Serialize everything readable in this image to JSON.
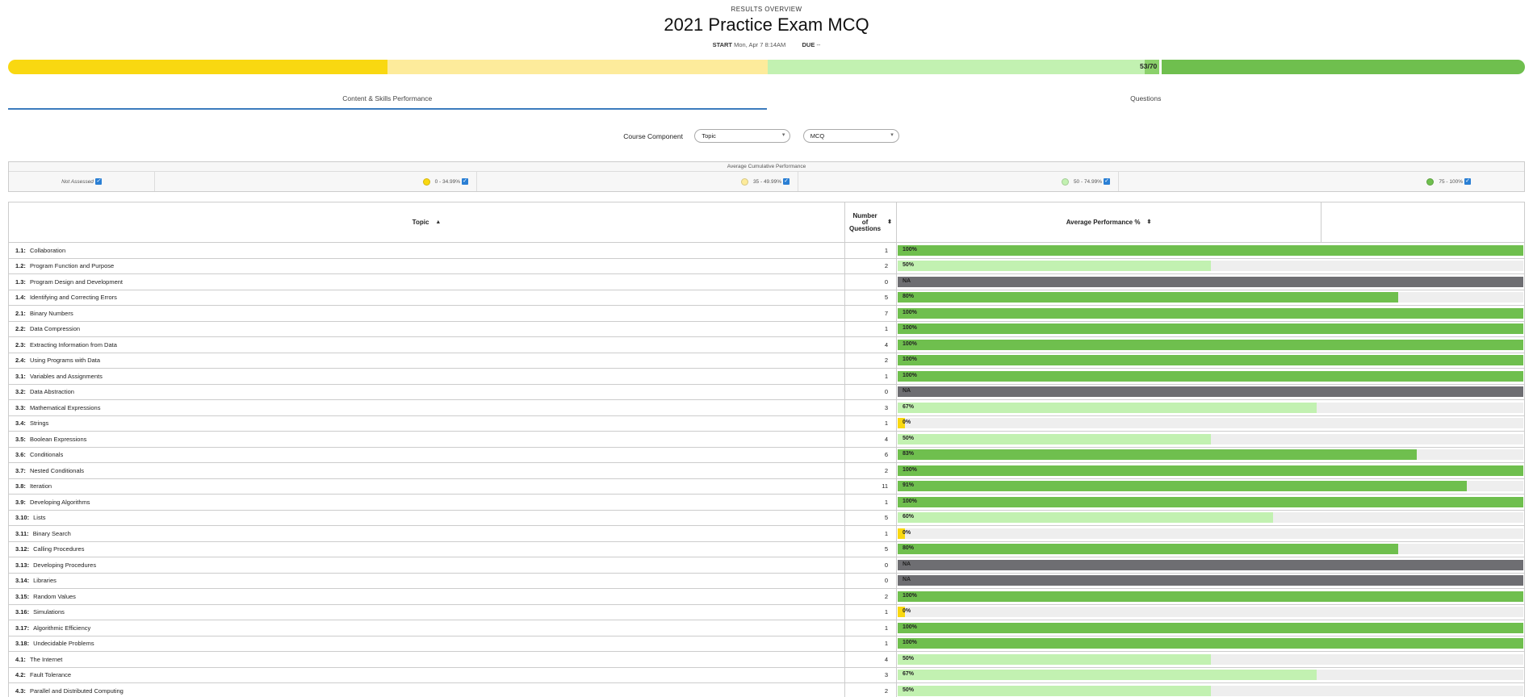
{
  "header": {
    "eyebrow": "RESULTS OVERVIEW",
    "title": "2021 Practice Exam MCQ",
    "start_label": "START",
    "start_value": "Mon, Apr 7 8:14AM",
    "due_label": "DUE",
    "due_value": "--"
  },
  "score": {
    "label": "53/70",
    "fraction": 0.757
  },
  "tabs": [
    {
      "label": "Content & Skills Performance",
      "active": true
    },
    {
      "label": "Questions",
      "active": false
    }
  ],
  "filters": {
    "label": "Course Component",
    "select1": "Topic",
    "select2": "MCQ"
  },
  "legend": {
    "title": "Average Cumulative Performance",
    "items": [
      {
        "label": "Not Assessed",
        "color": null
      },
      {
        "label": "0 - 34.99%",
        "color": "#f9d811"
      },
      {
        "label": "35 - 49.99%",
        "color": "#fdeb9b"
      },
      {
        "label": "50 - 74.99%",
        "color": "#c2f1b1"
      },
      {
        "label": "75 - 100%",
        "color": "#6fbf4e"
      }
    ]
  },
  "table": {
    "headers": {
      "topic": "Topic",
      "num_line1": "Number",
      "num_line2": "of",
      "num_line3": "Questions",
      "perf": "Average Performance %"
    },
    "rows": [
      {
        "code": "1.1:",
        "name": "Collaboration",
        "count": "1",
        "pct": 100,
        "label": "100%"
      },
      {
        "code": "1.2:",
        "name": "Program Function and Purpose",
        "count": "2",
        "pct": 50,
        "label": "50%"
      },
      {
        "code": "1.3:",
        "name": "Program Design and Development",
        "count": "0",
        "pct": null,
        "label": "NA"
      },
      {
        "code": "1.4:",
        "name": "Identifying and Correcting Errors",
        "count": "5",
        "pct": 80,
        "label": "80%"
      },
      {
        "code": "2.1:",
        "name": "Binary Numbers",
        "count": "7",
        "pct": 100,
        "label": "100%"
      },
      {
        "code": "2.2:",
        "name": "Data Compression",
        "count": "1",
        "pct": 100,
        "label": "100%"
      },
      {
        "code": "2.3:",
        "name": "Extracting Information from Data",
        "count": "4",
        "pct": 100,
        "label": "100%"
      },
      {
        "code": "2.4:",
        "name": "Using Programs with Data",
        "count": "2",
        "pct": 100,
        "label": "100%"
      },
      {
        "code": "3.1:",
        "name": "Variables and Assignments",
        "count": "1",
        "pct": 100,
        "label": "100%"
      },
      {
        "code": "3.2:",
        "name": "Data Abstraction",
        "count": "0",
        "pct": null,
        "label": "NA"
      },
      {
        "code": "3.3:",
        "name": "Mathematical Expressions",
        "count": "3",
        "pct": 67,
        "label": "67%"
      },
      {
        "code": "3.4:",
        "name": "Strings",
        "count": "1",
        "pct": 0,
        "label": "0%"
      },
      {
        "code": "3.5:",
        "name": "Boolean Expressions",
        "count": "4",
        "pct": 50,
        "label": "50%"
      },
      {
        "code": "3.6:",
        "name": "Conditionals",
        "count": "6",
        "pct": 83,
        "label": "83%"
      },
      {
        "code": "3.7:",
        "name": "Nested Conditionals",
        "count": "2",
        "pct": 100,
        "label": "100%"
      },
      {
        "code": "3.8:",
        "name": "Iteration",
        "count": "11",
        "pct": 91,
        "label": "91%"
      },
      {
        "code": "3.9:",
        "name": "Developing Algorithms",
        "count": "1",
        "pct": 100,
        "label": "100%"
      },
      {
        "code": "3.10:",
        "name": "Lists",
        "count": "5",
        "pct": 60,
        "label": "60%"
      },
      {
        "code": "3.11:",
        "name": "Binary Search",
        "count": "1",
        "pct": 0,
        "label": "0%"
      },
      {
        "code": "3.12:",
        "name": "Calling Procedures",
        "count": "5",
        "pct": 80,
        "label": "80%"
      },
      {
        "code": "3.13:",
        "name": "Developing Procedures",
        "count": "0",
        "pct": null,
        "label": "NA"
      },
      {
        "code": "3.14:",
        "name": "Libraries",
        "count": "0",
        "pct": null,
        "label": "NA"
      },
      {
        "code": "3.15:",
        "name": "Random Values",
        "count": "2",
        "pct": 100,
        "label": "100%"
      },
      {
        "code": "3.16:",
        "name": "Simulations",
        "count": "1",
        "pct": 0,
        "label": "0%"
      },
      {
        "code": "3.17:",
        "name": "Algorithmic Efficiency",
        "count": "1",
        "pct": 100,
        "label": "100%"
      },
      {
        "code": "3.18:",
        "name": "Undecidable Problems",
        "count": "1",
        "pct": 100,
        "label": "100%"
      },
      {
        "code": "4.1:",
        "name": "The Internet",
        "count": "4",
        "pct": 50,
        "label": "50%"
      },
      {
        "code": "4.2:",
        "name": "Fault Tolerance",
        "count": "3",
        "pct": 67,
        "label": "67%"
      },
      {
        "code": "4.3:",
        "name": "Parallel and Distributed Computing",
        "count": "2",
        "pct": 50,
        "label": "50%"
      }
    ]
  },
  "colors": {
    "low": "#f9d811",
    "midlow": "#fdeb9b",
    "midhigh": "#c2f1b1",
    "high": "#6fbf4e",
    "na": "#6e6e72",
    "accent": "#3c7bbd"
  }
}
